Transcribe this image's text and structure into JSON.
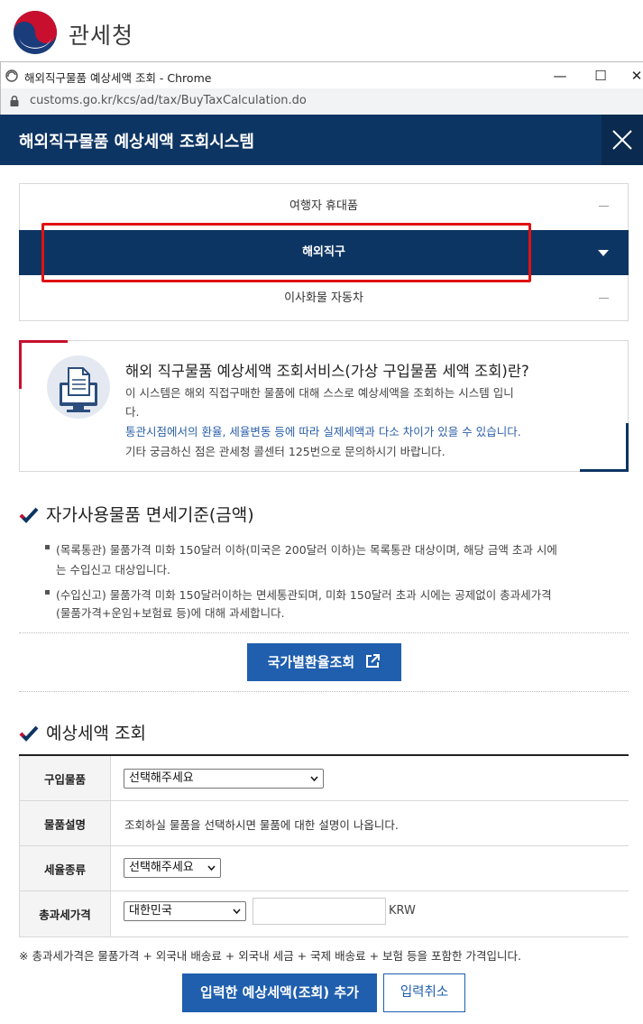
{
  "org": {
    "logo_text": "관세청"
  },
  "window": {
    "title": "해외직구물품 예상세액 조회 - Chrome",
    "url": "customs.go.kr/kcs/ad/tax/BuyTaxCalculation.do",
    "minimize": "—",
    "maximize": "☐",
    "close": "✕"
  },
  "header": {
    "title": "해외직구물품 예상세액 조회시스템"
  },
  "tabs": [
    {
      "label": "여행자 휴대품"
    },
    {
      "label": "해외직구"
    },
    {
      "label": "이사화물 자동차"
    }
  ],
  "info": {
    "title": "해외 직구물품 예상세액 조회서비스(가상 구입물품 세액 조회)란?",
    "line1": "이 시스템은 해외 직접구매한 물품에 대해 스스로 예상세액을 조회하는 시스템 입니",
    "line2": "다.",
    "line3": "통관시점에서의 환율, 세율변동 등에 따라 실제세액과 다소 차이가 있을 수 있습니다.",
    "line4": "기타 궁금하신 점은 관세청 콜센터 125번으로 문의하시기 바랍니다."
  },
  "exemption": {
    "title": "자가사용물품 면세기준(금액)",
    "bullet1_line1": "(목록통관) 물품가격 미화 150달러 이하(미국은 200달러 이하)는 목록통관 대상이며, 해당 금액 초과 시에",
    "bullet1_line2": "는 수입신고 대상입니다.",
    "bullet2_line1": "(수입신고) 물품가격 미화 150달러이하는 면세통관되며, 미화 150달러 초과 시에는 공제없이 총과세가격",
    "bullet2_line2": "(물품가격+운임+보험료 등)에 대해 과세합니다.",
    "exchange_button": "국가별환율조회"
  },
  "estimate": {
    "title": "예상세액 조회",
    "rows": {
      "item_label": "구입물품",
      "item_select": "선택해주세요",
      "desc_label": "물품설명",
      "desc_text": "조회하실 물품을 선택하시면 물품에 대한 설명이 나옵니다.",
      "rate_label": "세율종류",
      "rate_select": "선택해주세요",
      "value_label": "총과세가격",
      "country_select": "대한민국",
      "amount_value": "",
      "unit": "KRW"
    },
    "note": "※  총과세가격은 물품가격 + 외국내 배송료 + 외국내 세금 + 국제 배송료 + 보험 등을 포함한 가격입니다.",
    "submit_button": "입력한 예상세액(조회) 추가",
    "cancel_button": "입력취소"
  },
  "colors": {
    "navy": "#0d3563",
    "primary_blue": "#1f5fae",
    "highlight_red": "#e01212",
    "accent_red": "#c8102e"
  }
}
